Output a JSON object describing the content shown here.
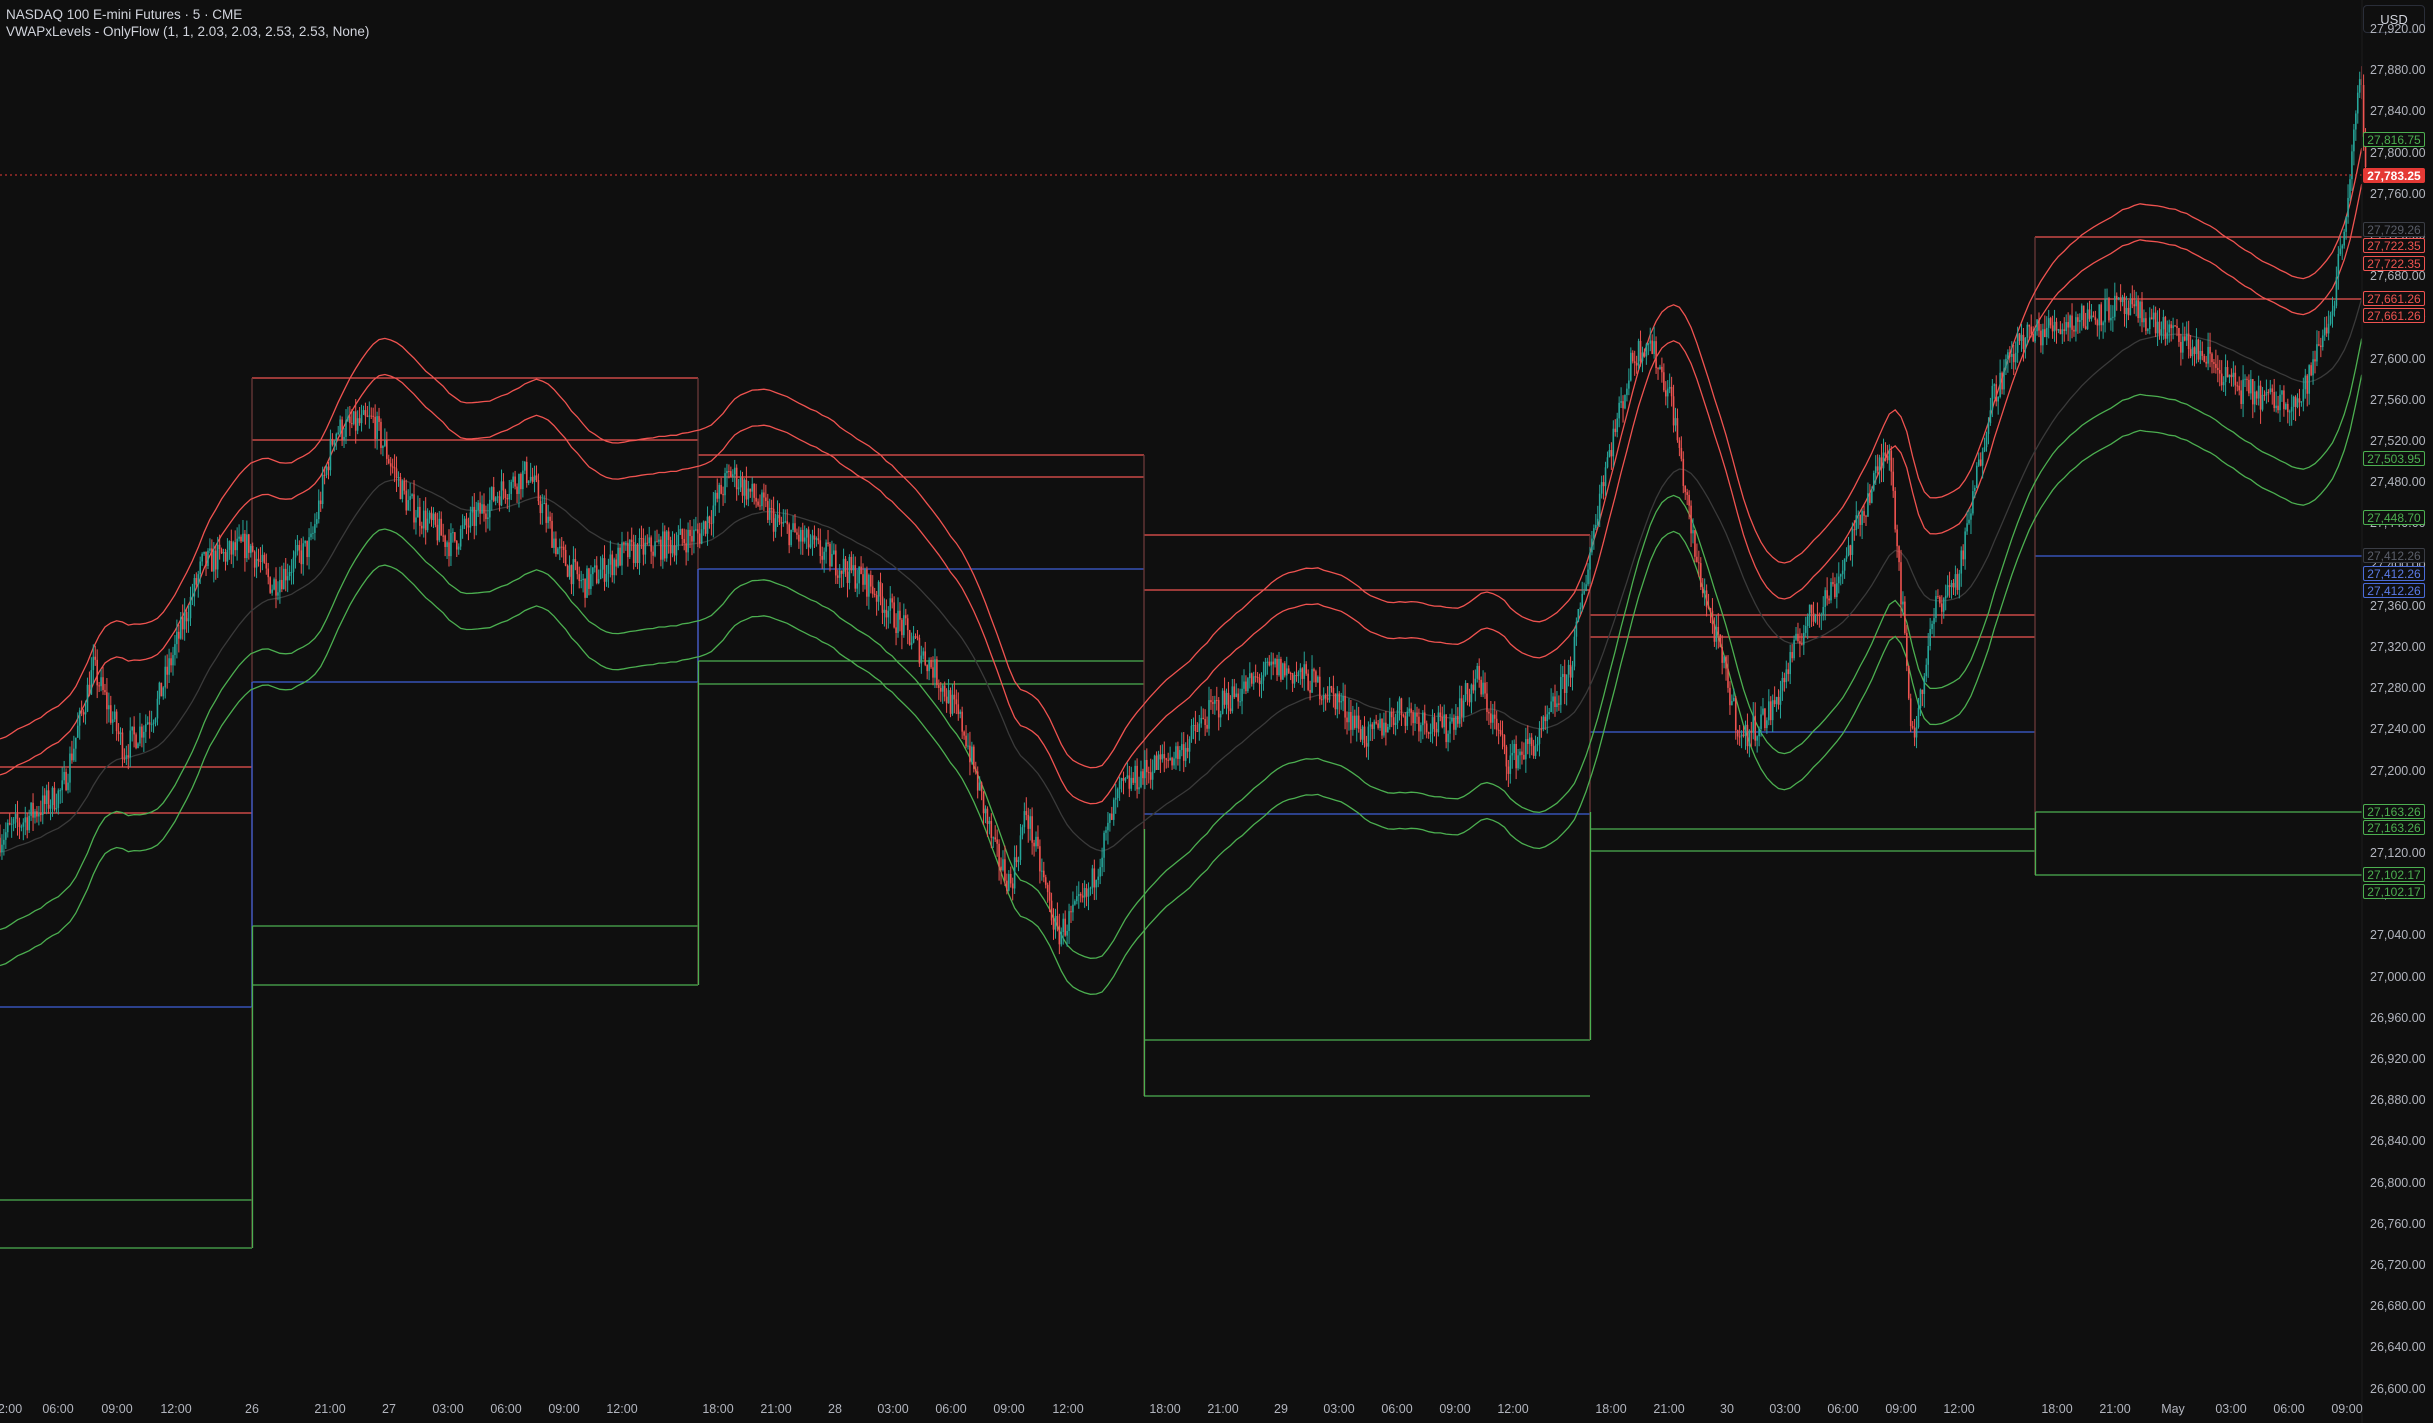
{
  "header": {
    "symbol_line": "NASDAQ 100 E-mini Futures · 5 · CME",
    "indicator_line": "VWAPxLevels - OnlyFlow (1, 1, 2.03, 2.03, 2.53, 2.53, None)"
  },
  "currency_button": "USD",
  "y_axis": {
    "labels": [
      "27,920.00",
      "27,880.00",
      "27,840.00",
      "27,800.00",
      "27,760.00",
      "27,720.00",
      "27,680.00",
      "27,640.00",
      "27,600.00",
      "27,560.00",
      "27,520.00",
      "27,480.00",
      "27,440.00",
      "27,400.00",
      "27,360.00",
      "27,320.00",
      "27,280.00",
      "27,240.00",
      "27,200.00",
      "27,160.00",
      "27,120.00",
      "27,080.00",
      "27,040.00",
      "27,000.00",
      "26,960.00",
      "26,920.00",
      "26,880.00",
      "26,840.00",
      "26,800.00",
      "26,760.00",
      "26,720.00",
      "26,680.00",
      "26,640.00",
      "26,600.00"
    ]
  },
  "x_axis": {
    "labels": [
      "2:00",
      "06:00",
      "09:00",
      "12:00",
      "26",
      "21:00",
      "27",
      "03:00",
      "06:00",
      "09:00",
      "12:00",
      "18:00",
      "21:00",
      "28",
      "03:00",
      "06:00",
      "09:00",
      "12:00",
      "18:00",
      "21:00",
      "29",
      "03:00",
      "06:00",
      "09:00",
      "12:00",
      "18:00",
      "21:00",
      "30",
      "03:00",
      "06:00",
      "09:00",
      "12:00",
      "18:00",
      "21:00",
      "May",
      "03:00",
      "06:00",
      "09:00"
    ]
  },
  "price_tags": [
    {
      "value": "27,816.75",
      "color": "green"
    },
    {
      "value": "27,783.25",
      "color": "last"
    },
    {
      "value": "27,729.26",
      "color": "gray"
    },
    {
      "value": "27,722.35",
      "color": "red"
    },
    {
      "value": "27,722.35",
      "color": "red"
    },
    {
      "value": "27,661.26",
      "color": "red"
    },
    {
      "value": "27,661.26",
      "color": "red"
    },
    {
      "value": "27,503.95",
      "color": "green"
    },
    {
      "value": "27,448.70",
      "color": "green"
    },
    {
      "value": "27,412.26",
      "color": "gray"
    },
    {
      "value": "27,412.26",
      "color": "blue"
    },
    {
      "value": "27,412.26",
      "color": "blue"
    },
    {
      "value": "27,163.26",
      "color": "green"
    },
    {
      "value": "27,163.26",
      "color": "green"
    },
    {
      "value": "27,102.17",
      "color": "green"
    },
    {
      "value": "27,102.17",
      "color": "green"
    }
  ],
  "colors": {
    "background": "#0f0f0f",
    "up_candle": "#26a69a",
    "down_candle": "#ef5350",
    "red_level": "#ef5350",
    "green_level": "#4caf50",
    "blue_level": "#3f5fd6",
    "vwap": "#3a3a3a"
  },
  "chart_data": {
    "type": "candlestick",
    "title": "NASDAQ 100 E-mini Futures · 5 · CME",
    "ylim": [
      26600,
      27940
    ],
    "close_path": [
      [
        0,
        27135
      ],
      [
        40,
        27180
      ],
      [
        60,
        27300
      ],
      [
        80,
        27220
      ],
      [
        100,
        27260
      ],
      [
        130,
        27400
      ],
      [
        160,
        27420
      ],
      [
        175,
        27380
      ],
      [
        200,
        27420
      ],
      [
        215,
        27530
      ],
      [
        240,
        27540
      ],
      [
        262,
        27460
      ],
      [
        290,
        27420
      ],
      [
        320,
        27470
      ],
      [
        340,
        27490
      ],
      [
        360,
        27410
      ],
      [
        375,
        27380
      ],
      [
        400,
        27410
      ],
      [
        430,
        27420
      ],
      [
        450,
        27430
      ],
      [
        470,
        27490
      ],
      [
        500,
        27440
      ],
      [
        520,
        27420
      ],
      [
        540,
        27400
      ],
      [
        560,
        27380
      ],
      [
        580,
        27340
      ],
      [
        600,
        27300
      ],
      [
        620,
        27240
      ],
      [
        640,
        27120
      ],
      [
        650,
        27090
      ],
      [
        660,
        27160
      ],
      [
        680,
        27040
      ],
      [
        700,
        27080
      ],
      [
        720,
        27180
      ],
      [
        737,
        27200
      ],
      [
        760,
        27220
      ],
      [
        780,
        27260
      ],
      [
        800,
        27280
      ],
      [
        820,
        27300
      ],
      [
        840,
        27290
      ],
      [
        860,
        27270
      ],
      [
        880,
        27230
      ],
      [
        900,
        27260
      ],
      [
        930,
        27240
      ],
      [
        950,
        27290
      ],
      [
        970,
        27210
      ],
      [
        990,
        27230
      ],
      [
        1010,
        27300
      ],
      [
        1030,
        27480
      ],
      [
        1050,
        27600
      ],
      [
        1060,
        27620
      ],
      [
        1075,
        27560
      ],
      [
        1090,
        27410
      ],
      [
        1105,
        27320
      ],
      [
        1120,
        27230
      ],
      [
        1140,
        27260
      ],
      [
        1160,
        27340
      ],
      [
        1180,
        27380
      ],
      [
        1200,
        27460
      ],
      [
        1215,
        27520
      ],
      [
        1230,
        27230
      ],
      [
        1245,
        27360
      ],
      [
        1260,
        27390
      ],
      [
        1280,
        27560
      ],
      [
        1300,
        27620
      ],
      [
        1320,
        27630
      ],
      [
        1340,
        27640
      ],
      [
        1360,
        27650
      ],
      [
        1380,
        27640
      ],
      [
        1400,
        27620
      ],
      [
        1420,
        27600
      ],
      [
        1440,
        27570
      ],
      [
        1460,
        27560
      ],
      [
        1480,
        27560
      ],
      [
        1500,
        27650
      ],
      [
        1510,
        27760
      ],
      [
        1518,
        27870
      ],
      [
        1522,
        27783
      ]
    ],
    "levels": [
      {
        "color": "red",
        "value": 27722.35
      },
      {
        "color": "red",
        "value": 27661.26
      },
      {
        "color": "gray",
        "value": 27729.26
      },
      {
        "color": "blue",
        "value": 27412.26
      },
      {
        "color": "green",
        "value": 27163.26
      },
      {
        "color": "green",
        "value": 27102.17
      },
      {
        "color": "green",
        "value": 27503.95
      },
      {
        "color": "green",
        "value": 27448.7
      }
    ],
    "last_price": 27783.25
  }
}
